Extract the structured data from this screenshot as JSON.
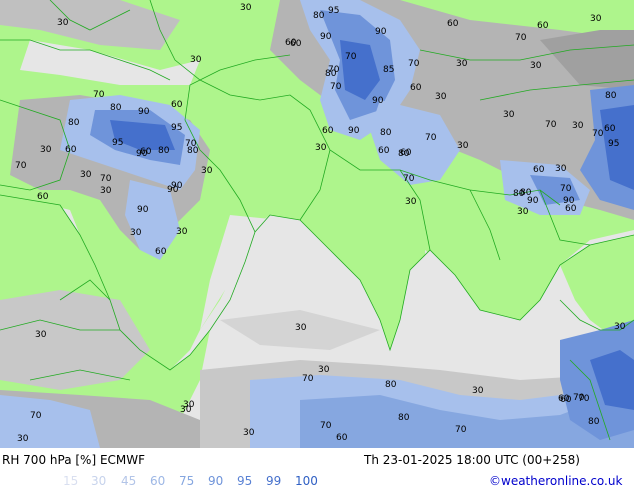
{
  "header": {
    "title": "RH 700 hPa [%] ECMWF",
    "run_info": "Th 23-01-2025 18:00 UTC (00+258)",
    "credit": "©weatheronline.co.uk"
  },
  "legend": {
    "items": [
      {
        "label": "15",
        "color": "#d9dff0"
      },
      {
        "label": "30",
        "color": "#c7d3ec"
      },
      {
        "label": "45",
        "color": "#b3c5e8"
      },
      {
        "label": "60",
        "color": "#9db7e5"
      },
      {
        "label": "75",
        "color": "#86a7e0"
      },
      {
        "label": "90",
        "color": "#6f94da"
      },
      {
        "label": "95",
        "color": "#5a82d4"
      },
      {
        "label": "99",
        "color": "#4570cc"
      },
      {
        "label": "100",
        "color": "#3060c4"
      }
    ]
  },
  "colors": {
    "land": "#aef58c",
    "sea_dry": "#e6e6e6",
    "gray_light": "#c8c8c8",
    "gray_mid": "#b4b4b4",
    "gray_dark": "#a0a0a0",
    "blue_light": "#a7c0ec",
    "blue_mid": "#6f94da",
    "blue_dark": "#4570cc",
    "border": "#22aa22"
  },
  "map": {
    "contour_labels": [
      "30",
      "80",
      "95",
      "90",
      "60",
      "60",
      "70",
      "30",
      "30",
      "60",
      "30",
      "30",
      "70",
      "30",
      "80",
      "90",
      "60",
      "80",
      "85",
      "70",
      "70",
      "95",
      "90",
      "60",
      "60",
      "30",
      "30",
      "80",
      "70",
      "95",
      "60",
      "70",
      "90",
      "60",
      "90",
      "30",
      "80",
      "70",
      "90",
      "80",
      "60",
      "80",
      "90",
      "70",
      "30",
      "30",
      "70",
      "30",
      "90",
      "30",
      "60",
      "80",
      "60",
      "30",
      "70",
      "30",
      "70",
      "95",
      "60",
      "70",
      "90",
      "70",
      "80",
      "60",
      "30",
      "30",
      "60",
      "30",
      "60",
      "30",
      "90",
      "80",
      "90",
      "30",
      "80",
      "30",
      "70",
      "30",
      "30",
      "80",
      "70",
      "30",
      "30",
      "70",
      "30",
      "60",
      "70",
      "60",
      "30",
      "70",
      "30",
      "60",
      "70",
      "80",
      "80",
      "30",
      "70",
      "60"
    ]
  }
}
